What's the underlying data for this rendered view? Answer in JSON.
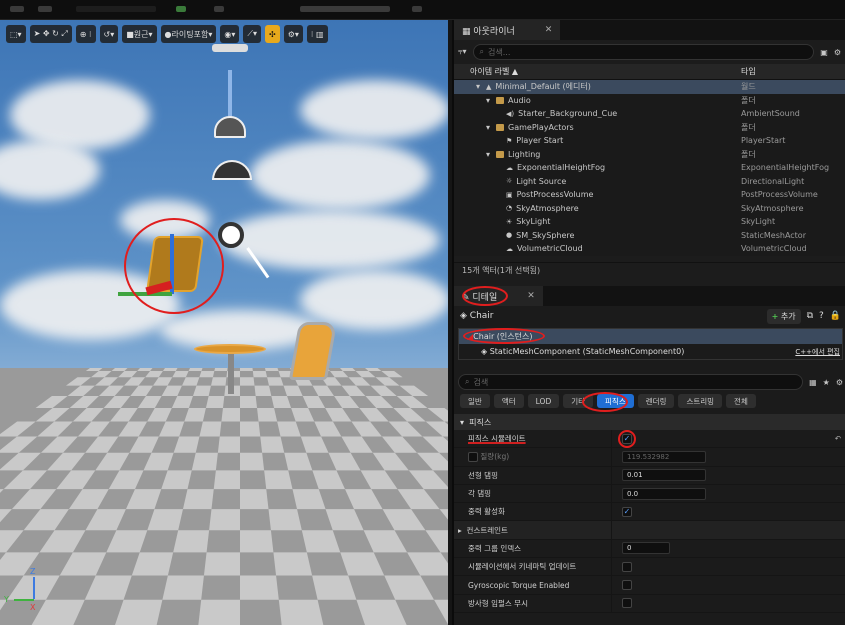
{
  "viewport": {
    "toolbar": [
      "원근",
      "라이팅포함"
    ],
    "axis": {
      "z": "Z",
      "x": "X",
      "y": "Y"
    }
  },
  "outliner": {
    "tab": "아웃라이너",
    "search_placeholder": "검색...",
    "col_label": "아이템 라벨 ▲",
    "col_type": "타입",
    "rows": [
      {
        "label": "Minimal_Default (에디터)",
        "type": "월드"
      },
      {
        "label": "Audio",
        "type": "폴더"
      },
      {
        "label": "Starter_Background_Cue",
        "type": "AmbientSound"
      },
      {
        "label": "GamePlayActors",
        "type": "폴더"
      },
      {
        "label": "Player Start",
        "type": "PlayerStart"
      },
      {
        "label": "Lighting",
        "type": "폴더"
      },
      {
        "label": "ExponentialHeightFog",
        "type": "ExponentialHeightFog"
      },
      {
        "label": "Light Source",
        "type": "DirectionalLight"
      },
      {
        "label": "PostProcessVolume",
        "type": "PostProcessVolume"
      },
      {
        "label": "SkyAtmosphere",
        "type": "SkyAtmosphere"
      },
      {
        "label": "SkyLight",
        "type": "SkyLight"
      },
      {
        "label": "SM_SkySphere",
        "type": "StaticMeshActor"
      },
      {
        "label": "VolumetricCloud",
        "type": "VolumetricCloud"
      }
    ],
    "status": "15개 액터(1개 선택됨)"
  },
  "details": {
    "tab": "디테일",
    "actor": "Chair",
    "add_label": "추가",
    "instance": "Chair (인스턴스)",
    "component": "StaticMeshComponent (StaticMeshComponent0)",
    "component_link": "C++에서 편집",
    "search_placeholder": "검색",
    "filters": [
      "일반",
      "액터",
      "LOD",
      "기타",
      "피직스",
      "렌더링",
      "스트리밍",
      "전체"
    ],
    "section": "피직스",
    "props": {
      "simulate": "피직스 시뮬레이트",
      "mass_label": "질량(kg)",
      "mass_value": "119.532982",
      "linear_label": "선형 댐핑",
      "linear_value": "0.01",
      "angular_label": "각 댐핑",
      "angular_value": "0.0",
      "gravity_label": "중력 활성화",
      "constraints": "컨스트레인트",
      "ignore_group_label": "중력 그룹 인덱스",
      "ignore_group_value": "0",
      "kinematic_label": "시뮬레이션에서 키네마틱 업데이트",
      "gyro_label": "Gyroscopic Torque Enabled",
      "radial_label": "방사형 임펄스 무시"
    }
  }
}
